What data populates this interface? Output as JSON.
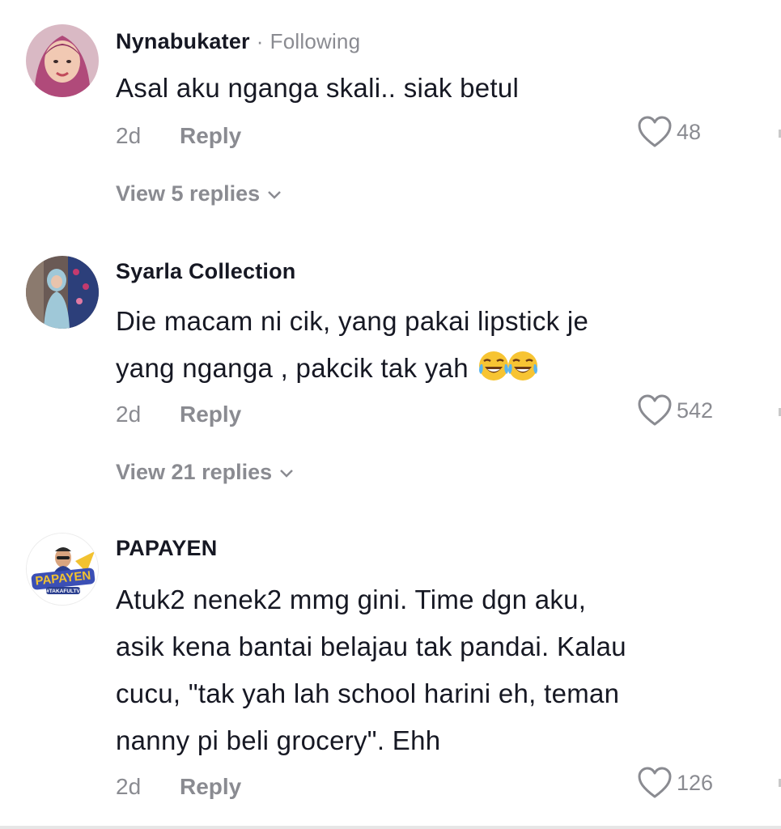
{
  "comments": [
    {
      "username": "Nynabukater",
      "following": "Following",
      "text": "Asal aku nganga skali.. siak betul",
      "time": "2d",
      "reply": "Reply",
      "likes": "48",
      "view_replies": "View 5 replies"
    },
    {
      "username": "Syarla Collection",
      "text_line1": "Die macam ni cik, yang pakai lipstick je",
      "text_line2": "yang nganga , pakcik tak yah",
      "emojis": [
        "face-with-tears-of-joy-icon",
        "face-with-tears-of-joy-icon"
      ],
      "time": "2d",
      "reply": "Reply",
      "likes": "542",
      "view_replies": "View 21 replies"
    },
    {
      "username": "PAPAYEN",
      "avatar_badge": "PAPAYEN",
      "avatar_badge_sub": "#TAKAFULTV",
      "text_lines": [
        "Atuk2 nenek2 mmg gini. Time dgn aku,",
        "asik kena bantai belajau tak pandai. Kalau",
        "cucu, \"tak yah lah school harini eh, teman",
        "nanny pi beli grocery\". Ehh"
      ],
      "time": "2d",
      "reply": "Reply",
      "likes": "126"
    }
  ],
  "colors": {
    "text": "#161823",
    "muted": "#8a8b91",
    "background": "#ffffff"
  }
}
